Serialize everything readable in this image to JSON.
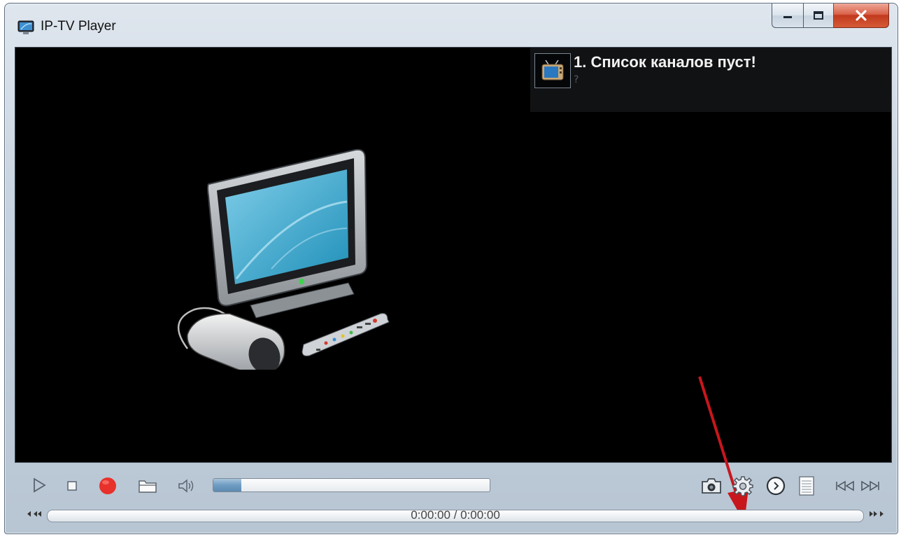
{
  "window": {
    "title": "IP-TV Player",
    "icons": {
      "app": "tv-app-icon",
      "minimize": "minimize-icon",
      "maximize": "maximize-icon",
      "close": "close-icon"
    }
  },
  "channel_panel": {
    "title": "1. Список каналов пуст!",
    "subtitle": "?",
    "icon": "tv-channel-icon"
  },
  "player": {
    "volume_fill_fraction": 0.1,
    "time_display": "0:00:00 / 0:00:00",
    "icons": {
      "play": "play-icon",
      "stop": "stop-icon",
      "record": "record-icon",
      "open": "folder-icon",
      "volume": "speaker-icon",
      "snapshot": "camera-icon",
      "settings": "gear-icon",
      "timer": "clock-icon",
      "playlist": "list-icon",
      "prev": "prev-channel-icon",
      "next": "next-channel-icon",
      "seek_back": "rewind-icon",
      "seek_forward": "forward-icon"
    }
  },
  "colors": {
    "accent_record": "#e8312a",
    "progress_fill": "#6f9cc2",
    "annotation_arrow": "#c8161d",
    "video_bg": "#000000"
  }
}
